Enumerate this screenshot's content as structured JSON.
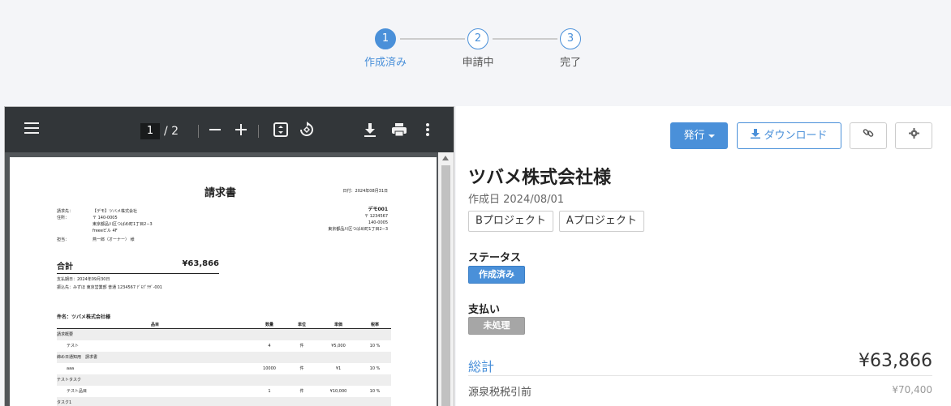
{
  "stepper": {
    "steps": [
      {
        "num": "1",
        "label": "作成済み"
      },
      {
        "num": "2",
        "label": "申請中"
      },
      {
        "num": "3",
        "label": "完了"
      }
    ]
  },
  "viewer": {
    "page_current": "1",
    "page_total": "/ 2",
    "doc": {
      "title": "請求書",
      "date": "日付：2024年08月31日",
      "info": [
        {
          "k": "請求先：",
          "v": "【デモ】ツバメ株式会社"
        },
        {
          "k": "住所：",
          "v": "〒 140-0005"
        },
        {
          "k": "",
          "v": "東京都品川区つばめ町1丁目2−3"
        },
        {
          "k": "",
          "v": "freeeビル 4F"
        },
        {
          "k": "担当：",
          "v": "燕一郎（オーナー） 様"
        }
      ],
      "sender": {
        "name": "デモ001",
        "lines": [
          "〒 1234567",
          "140-0005",
          "東京都品川区つばめ町1丁目2−3"
        ]
      },
      "total_label": "合計",
      "total_value": "¥63,866",
      "due": "支払期日：2024年09月30日",
      "bank": "振込先：みずほ 東京営業部 普通 1234567 ﾃﾞﾓｸﾞﾁｻﾞ-001",
      "subject": "件名：ツバメ株式会社様",
      "headers": [
        "品目",
        "数量",
        "単位",
        "単価",
        "税率"
      ],
      "rows": [
        {
          "group": true,
          "name": "請求概要",
          "qty": "",
          "unit": "",
          "price": "",
          "tax": ""
        },
        {
          "group": false,
          "name": "テスト",
          "qty": "4",
          "unit": "件",
          "price": "¥5,000",
          "tax": "10 %"
        },
        {
          "group": true,
          "name": "締め日通知用　請求書",
          "qty": "",
          "unit": "",
          "price": "",
          "tax": ""
        },
        {
          "group": false,
          "name": "aaa",
          "qty": "10000",
          "unit": "件",
          "price": "¥1",
          "tax": "10 %"
        },
        {
          "group": true,
          "name": "テストタスク",
          "qty": "",
          "unit": "",
          "price": "",
          "tax": ""
        },
        {
          "group": false,
          "name": "テスト品目",
          "qty": "1",
          "unit": "件",
          "price": "¥10,000",
          "tax": "10 %"
        },
        {
          "group": true,
          "name": "タスク1",
          "qty": "",
          "unit": "",
          "price": "",
          "tax": ""
        }
      ]
    }
  },
  "panel": {
    "issue_label": "発行",
    "download_label": "ダウンロード",
    "client_name": "ツバメ株式会社様",
    "created": "作成日 2024/08/01",
    "tags": [
      "Bプロジェクト",
      "Aプロジェクト"
    ],
    "status_label": "ステータス",
    "status_badge": "作成済み",
    "payment_label": "支払い",
    "payment_badge": "未処理",
    "total_label": "総計",
    "total_value": "¥63,866",
    "withholding_label": "源泉税税引前",
    "withholding_value": "¥70,400"
  },
  "colors": {
    "accent": "#4a90d9",
    "toolbar": "#323639",
    "viewer_bg": "#525659"
  },
  "icons": [
    "menu-icon",
    "minus-icon",
    "plus-icon",
    "fit-page-icon",
    "rotate-icon",
    "download-icon",
    "print-icon",
    "more-icon",
    "link-icon",
    "gear-icon"
  ]
}
